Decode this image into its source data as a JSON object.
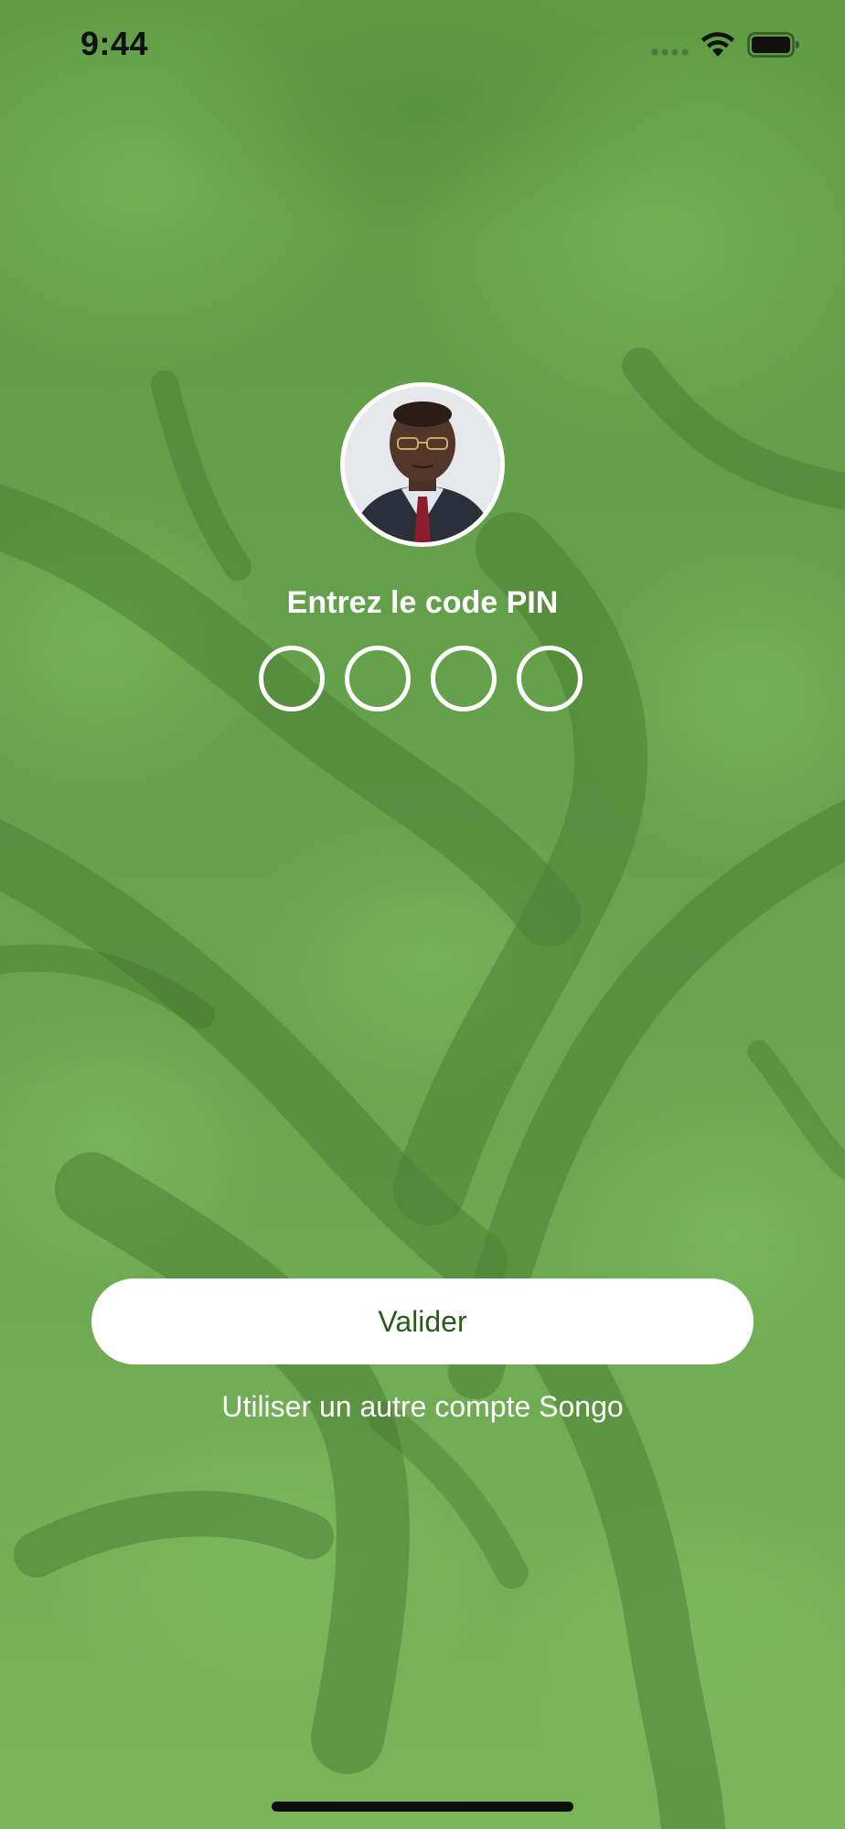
{
  "status_bar": {
    "time": "9:44",
    "icons": [
      "cellular-signal-icon",
      "wifi-icon",
      "battery-icon"
    ]
  },
  "login": {
    "avatar": "user-avatar-photo",
    "title": "Entrez le code PIN",
    "pin_length": 4,
    "pin_digits_entered": 0
  },
  "actions": {
    "validate_label": "Valider",
    "other_account_label": "Utiliser un autre compte Songo"
  },
  "colors": {
    "background_green": "#6aa64e",
    "button_background": "#ffffff",
    "button_text": "#2d5a1e",
    "text_white": "#ffffff"
  }
}
